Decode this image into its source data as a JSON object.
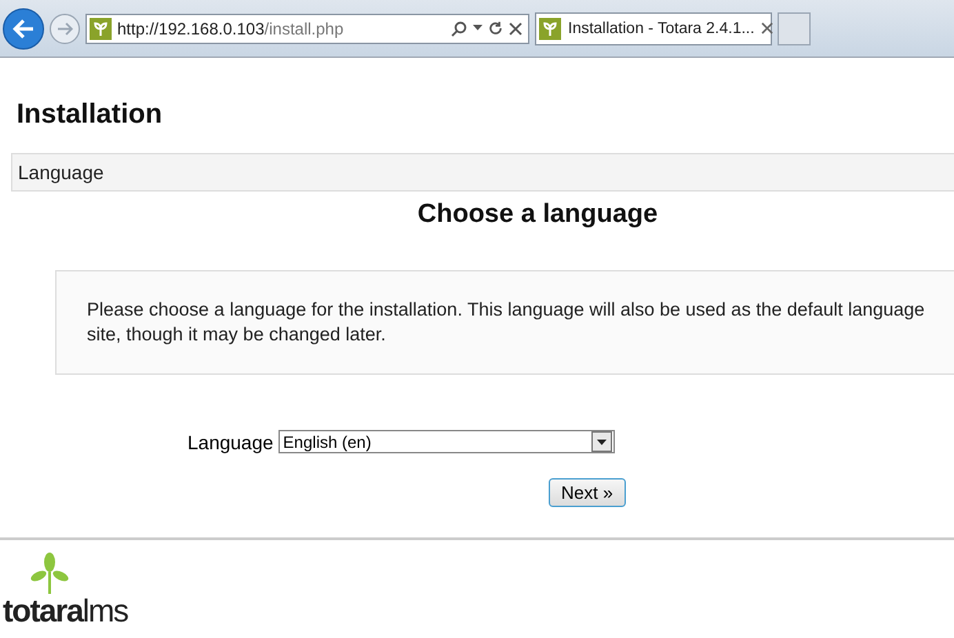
{
  "browser": {
    "url_host": "http://192.168.0.103",
    "url_path": "/install.php",
    "tab_title": "Installation - Totara 2.4.1..."
  },
  "page": {
    "heading": "Installation",
    "breadcrumb": "Language",
    "title": "Choose a language",
    "intro_lines": [
      "Please choose a language for the installation. This language will also be used as the default language",
      "site, though it may be changed later."
    ],
    "language_label": "Language",
    "language_value": "English (en)",
    "next_button": "Next »"
  },
  "footer": {
    "logo_bold": "totara",
    "logo_light": "lms"
  }
}
